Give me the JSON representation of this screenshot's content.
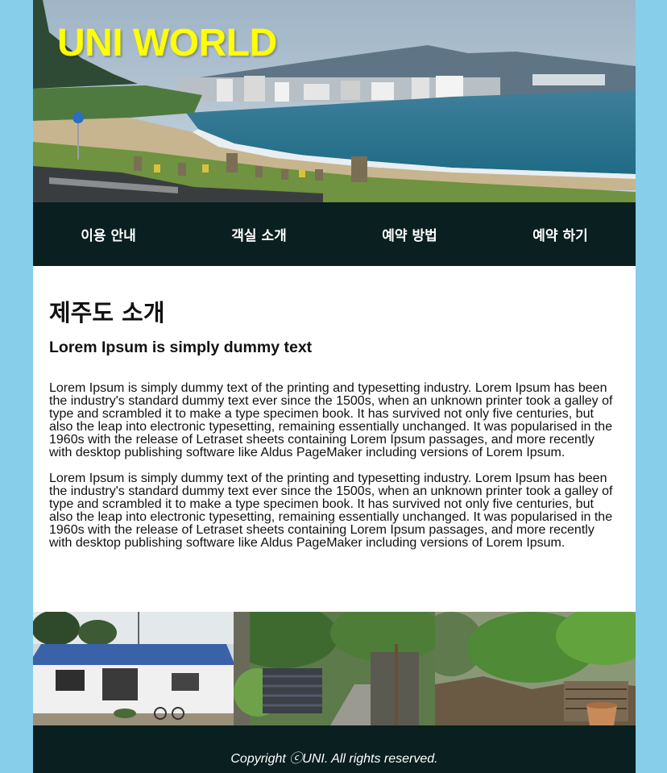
{
  "header": {
    "site_title": "UNI WORLD"
  },
  "nav": {
    "items": [
      {
        "label": "이용 안내"
      },
      {
        "label": "객실 소개"
      },
      {
        "label": "예약 방법"
      },
      {
        "label": "예약 하기"
      }
    ]
  },
  "main": {
    "heading": "제주도 소개",
    "subheading": "Lorem Ipsum is simply dummy text",
    "paragraphs": [
      "Lorem Ipsum is simply dummy text of the printing and typesetting industry. Lorem Ipsum has been the industry's standard dummy text ever since the 1500s, when an unknown printer took a galley of type and scrambled it to make a type specimen book. It has survived not only five centuries, but also the leap into electronic typesetting, remaining essentially unchanged. It was popularised in the 1960s with the release of Letraset sheets containing Lorem Ipsum passages, and more recently with desktop publishing software like Aldus PageMaker including versions of Lorem Ipsum.",
      "Lorem Ipsum is simply dummy text of the printing and typesetting industry. Lorem Ipsum has been the industry's standard dummy text ever since the 1500s, when an unknown printer took a galley of type and scrambled it to make a type specimen book. It has survived not only five centuries, but also the leap into electronic typesetting, remaining essentially unchanged. It was popularised in the 1960s with the release of Letraset sheets containing Lorem Ipsum passages, and more recently with desktop publishing software like Aldus PageMaker including versions of Lorem Ipsum."
    ]
  },
  "gallery": {
    "photos": [
      {
        "subject": "house-photo"
      },
      {
        "subject": "alley-photo"
      },
      {
        "subject": "garden-photo"
      }
    ]
  },
  "footer": {
    "copyright": "Copyright ⓒUNI. All rights reserved."
  },
  "colors": {
    "background": "#87ceeb",
    "nav_footer": "#0a1f1f",
    "title": "#ffff00"
  }
}
